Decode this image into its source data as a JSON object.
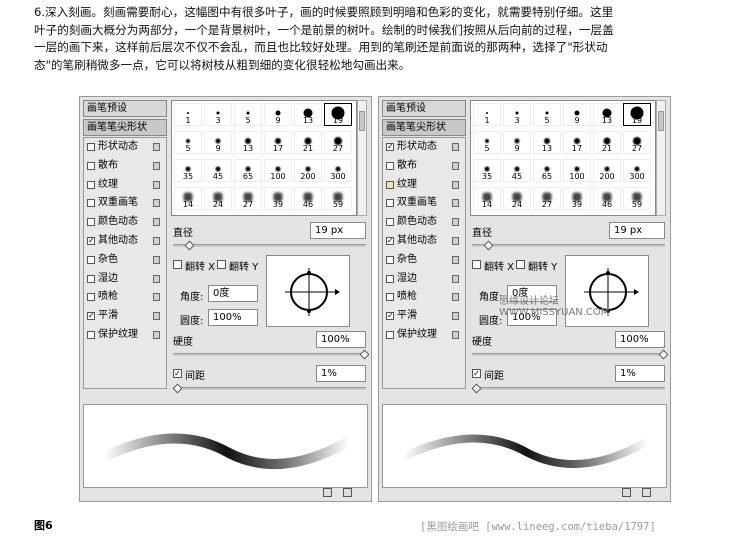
{
  "intro_lines": [
    "6.深入刻画。刻画需要耐心，这幅图中有很多叶子，画的时候要照顾到明暗和色彩的变化，就需要特别仔细。这里",
    "叶子的刻画大概分为两部分，一个是背景树叶，一个是前景的树叶。绘制的时候我们按照从后向前的过程，一层盖",
    "一层的画下来，这样前后层次不仅不会乱，而且也比较好处理。用到的笔刷还是前面说的那两种，选择了\"形状动",
    "态\"的笔刷稍微多一点，它可以将树枝从粗到细的变化很轻松地勾画出来。"
  ],
  "panels": [
    {
      "preset_tab": "画笔预设",
      "shape_tab": "画笔笔尖形状",
      "options": [
        {
          "label": "形状动态",
          "checked": false
        },
        {
          "label": "散布",
          "checked": false
        },
        {
          "label": "纹理",
          "checked": false
        },
        {
          "label": "双重画笔",
          "checked": false
        },
        {
          "label": "颜色动态",
          "checked": false
        },
        {
          "label": "其他动态",
          "checked": true
        },
        {
          "label": "杂色",
          "checked": false
        },
        {
          "label": "湿边",
          "checked": false
        },
        {
          "label": "喷枪",
          "checked": false
        },
        {
          "label": "平滑",
          "checked": true
        },
        {
          "label": "保护纹理",
          "checked": false
        }
      ],
      "diameter_label": "直径",
      "diameter_value": "19 px",
      "flip_x": "翻转 X",
      "flip_y": "翻转 Y",
      "angle_label": "角度:",
      "angle_value": "0度",
      "roundness_label": "圆度:",
      "roundness_value": "100%",
      "hardness_label": "硬度",
      "hardness_value": "100%",
      "spacing_label": "间距",
      "spacing_value": "1%",
      "overlay_text": ""
    },
    {
      "preset_tab": "画笔预设",
      "shape_tab": "画笔笔尖形状",
      "options": [
        {
          "label": "形状动态",
          "checked": true
        },
        {
          "label": "散布",
          "checked": false
        },
        {
          "label": "纹理",
          "checked": false
        },
        {
          "label": "双重画笔",
          "checked": false
        },
        {
          "label": "颜色动态",
          "checked": false
        },
        {
          "label": "其他动态",
          "checked": true
        },
        {
          "label": "杂色",
          "checked": false
        },
        {
          "label": "湿边",
          "checked": false
        },
        {
          "label": "喷枪",
          "checked": false
        },
        {
          "label": "平滑",
          "checked": true
        },
        {
          "label": "保护纹理",
          "checked": false
        }
      ],
      "diameter_label": "直径",
      "diameter_value": "19 px",
      "flip_x": "翻转 X",
      "flip_y": "翻转 Y",
      "angle_label": "角度:",
      "angle_value": "0度",
      "roundness_label": "圆度:",
      "roundness_value": "100%",
      "hardness_label": "硬度",
      "hardness_value": "100%",
      "spacing_label": "间距",
      "spacing_value": "1%",
      "overlay_text": "思缘设计论坛   WWW.MISSYUAN.COM"
    }
  ],
  "brush_sizes": [
    "1",
    "3",
    "5",
    "9",
    "13",
    "19",
    "5",
    "9",
    "13",
    "17",
    "21",
    "27",
    "35",
    "45",
    "65",
    "100",
    "200",
    "300",
    "14",
    "24",
    "27",
    "39",
    "46",
    "59"
  ],
  "figure_label": "图6",
  "watermark": "[黑图绘画吧 [www.lineeg.com/tieba/1797]"
}
